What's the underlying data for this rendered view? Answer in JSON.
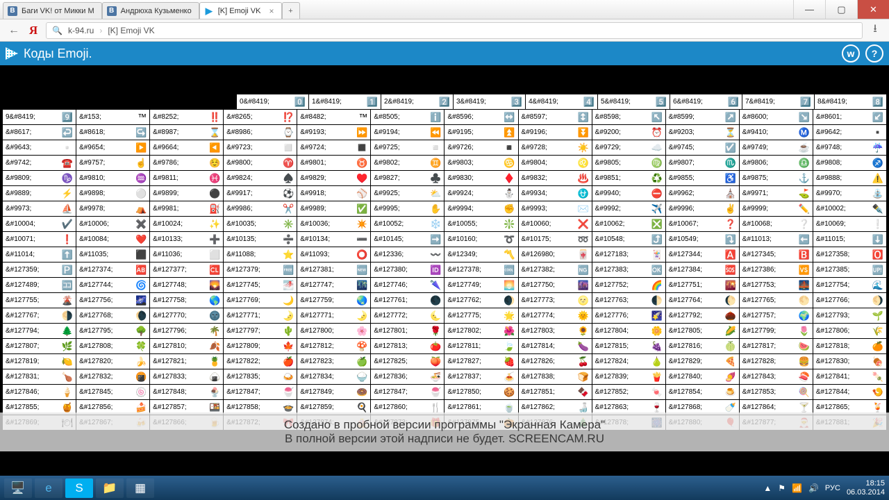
{
  "tabs": [
    {
      "fav": "vk",
      "label": "Баги VK! от Микки М"
    },
    {
      "fav": "vk",
      "label": "Андрюха Кузьменко"
    },
    {
      "fav": "play",
      "label": "[K] Emoji VK"
    }
  ],
  "address": {
    "host": "k-94.ru",
    "title": "[K] Emoji VK"
  },
  "header": {
    "title": "Коды Emoji."
  },
  "watermark": {
    "line1": "Создано в пробной версии программы \"Экранная Камера\"",
    "line2": "В полной версии этой надписи не будет. SCREENCAM.RU"
  },
  "tray": {
    "lang": "РУС",
    "time": "18:15",
    "date": "06.03.2014"
  },
  "firstRow": [
    {
      "c": "0&#8419;",
      "e": "0️⃣"
    },
    {
      "c": "1&#8419;",
      "e": "1️⃣"
    },
    {
      "c": "2&#8419;",
      "e": "2️⃣"
    },
    {
      "c": "3&#8419;",
      "e": "3️⃣"
    },
    {
      "c": "4&#8419;",
      "e": "4️⃣"
    },
    {
      "c": "5&#8419;",
      "e": "5️⃣"
    },
    {
      "c": "6&#8419;",
      "e": "6️⃣"
    },
    {
      "c": "7&#8419;",
      "e": "7️⃣"
    },
    {
      "c": "8&#8419;",
      "e": "8️⃣"
    }
  ],
  "rows": [
    [
      {
        "c": "9&#8419;",
        "e": "9️⃣"
      },
      {
        "c": "&#153;",
        "e": "™"
      },
      {
        "c": "&#8252;",
        "e": "‼️"
      },
      {
        "c": "&#8265;",
        "e": "⁉️"
      },
      {
        "c": "&#8482;",
        "e": "™"
      },
      {
        "c": "&#8505;",
        "e": "ℹ️"
      },
      {
        "c": "&#8596;",
        "e": "↔️"
      },
      {
        "c": "&#8597;",
        "e": "↕️"
      },
      {
        "c": "&#8598;",
        "e": "↖️"
      },
      {
        "c": "&#8599;",
        "e": "↗️"
      },
      {
        "c": "&#8600;",
        "e": "↘️"
      },
      {
        "c": "&#8601;",
        "e": "↙️"
      }
    ],
    [
      {
        "c": "&#8617;",
        "e": "↩️"
      },
      {
        "c": "&#8618;",
        "e": "↪️"
      },
      {
        "c": "&#8987;",
        "e": "⌛"
      },
      {
        "c": "&#8986;",
        "e": "⌚"
      },
      {
        "c": "&#9193;",
        "e": "⏩"
      },
      {
        "c": "&#9194;",
        "e": "⏪"
      },
      {
        "c": "&#9195;",
        "e": "⏫"
      },
      {
        "c": "&#9196;",
        "e": "⏬"
      },
      {
        "c": "&#9200;",
        "e": "⏰"
      },
      {
        "c": "&#9203;",
        "e": "⏳"
      },
      {
        "c": "&#9410;",
        "e": "Ⓜ️"
      },
      {
        "c": "&#9642;",
        "e": "▪️"
      }
    ],
    [
      {
        "c": "&#9643;",
        "e": "▫️"
      },
      {
        "c": "&#9654;",
        "e": "▶️"
      },
      {
        "c": "&#9664;",
        "e": "◀️"
      },
      {
        "c": "&#9723;",
        "e": "◻️"
      },
      {
        "c": "&#9724;",
        "e": "◼️"
      },
      {
        "c": "&#9725;",
        "e": "◽"
      },
      {
        "c": "&#9726;",
        "e": "◾"
      },
      {
        "c": "&#9728;",
        "e": "☀️"
      },
      {
        "c": "&#9729;",
        "e": "☁️"
      },
      {
        "c": "&#9745;",
        "e": "☑️"
      },
      {
        "c": "&#9749;",
        "e": "☕"
      },
      {
        "c": "&#9748;",
        "e": "☔"
      }
    ],
    [
      {
        "c": "&#9742;",
        "e": "☎️"
      },
      {
        "c": "&#9757;",
        "e": "☝️"
      },
      {
        "c": "&#9786;",
        "e": "☺️"
      },
      {
        "c": "&#9800;",
        "e": "♈"
      },
      {
        "c": "&#9801;",
        "e": "♉"
      },
      {
        "c": "&#9802;",
        "e": "♊"
      },
      {
        "c": "&#9803;",
        "e": "♋"
      },
      {
        "c": "&#9804;",
        "e": "♌"
      },
      {
        "c": "&#9805;",
        "e": "♍"
      },
      {
        "c": "&#9807;",
        "e": "♏"
      },
      {
        "c": "&#9806;",
        "e": "♎"
      },
      {
        "c": "&#9808;",
        "e": "♐"
      }
    ],
    [
      {
        "c": "&#9809;",
        "e": "♑"
      },
      {
        "c": "&#9810;",
        "e": "♒"
      },
      {
        "c": "&#9811;",
        "e": "♓"
      },
      {
        "c": "&#9824;",
        "e": "♠️"
      },
      {
        "c": "&#9829;",
        "e": "♥️"
      },
      {
        "c": "&#9827;",
        "e": "♣️"
      },
      {
        "c": "&#9830;",
        "e": "♦️"
      },
      {
        "c": "&#9832;",
        "e": "♨️"
      },
      {
        "c": "&#9851;",
        "e": "♻️"
      },
      {
        "c": "&#9855;",
        "e": "♿"
      },
      {
        "c": "&#9875;",
        "e": "⚓"
      },
      {
        "c": "&#9888;",
        "e": "⚠️"
      }
    ],
    [
      {
        "c": "&#9889;",
        "e": "⚡"
      },
      {
        "c": "&#9898;",
        "e": "⚪"
      },
      {
        "c": "&#9899;",
        "e": "⚫"
      },
      {
        "c": "&#9917;",
        "e": "⚽"
      },
      {
        "c": "&#9918;",
        "e": "⚾"
      },
      {
        "c": "&#9925;",
        "e": "⛅"
      },
      {
        "c": "&#9924;",
        "e": "⛄"
      },
      {
        "c": "&#9934;",
        "e": "⛎"
      },
      {
        "c": "&#9940;",
        "e": "⛔"
      },
      {
        "c": "&#9962;",
        "e": "⛪"
      },
      {
        "c": "&#9971;",
        "e": "⛳"
      },
      {
        "c": "&#9970;",
        "e": "⛲"
      }
    ],
    [
      {
        "c": "&#9973;",
        "e": "⛵"
      },
      {
        "c": "&#9978;",
        "e": "⛺"
      },
      {
        "c": "&#9981;",
        "e": "⛽"
      },
      {
        "c": "&#9986;",
        "e": "✂️"
      },
      {
        "c": "&#9989;",
        "e": "✅"
      },
      {
        "c": "&#9995;",
        "e": "✋"
      },
      {
        "c": "&#9994;",
        "e": "✊"
      },
      {
        "c": "&#9993;",
        "e": "✉️"
      },
      {
        "c": "&#9992;",
        "e": "✈️"
      },
      {
        "c": "&#9996;",
        "e": "✌️"
      },
      {
        "c": "&#9999;",
        "e": "✏️"
      },
      {
        "c": "&#10002;",
        "e": "✒️"
      }
    ],
    [
      {
        "c": "&#10004;",
        "e": "✔️"
      },
      {
        "c": "&#10006;",
        "e": "✖️"
      },
      {
        "c": "&#10024;",
        "e": "✨"
      },
      {
        "c": "&#10035;",
        "e": "✳️"
      },
      {
        "c": "&#10036;",
        "e": "✴️"
      },
      {
        "c": "&#10052;",
        "e": "❄️"
      },
      {
        "c": "&#10055;",
        "e": "❇️"
      },
      {
        "c": "&#10060;",
        "e": "❌"
      },
      {
        "c": "&#10062;",
        "e": "❎"
      },
      {
        "c": "&#10067;",
        "e": "❓"
      },
      {
        "c": "&#10068;",
        "e": "❔"
      },
      {
        "c": "&#10069;",
        "e": "❕"
      }
    ],
    [
      {
        "c": "&#10071;",
        "e": "❗"
      },
      {
        "c": "&#10084;",
        "e": "❤️"
      },
      {
        "c": "&#10133;",
        "e": "➕"
      },
      {
        "c": "&#10135;",
        "e": "➗"
      },
      {
        "c": "&#10134;",
        "e": "➖"
      },
      {
        "c": "&#10145;",
        "e": "➡️"
      },
      {
        "c": "&#10160;",
        "e": "➰"
      },
      {
        "c": "&#10175;",
        "e": "➿"
      },
      {
        "c": "&#10548;",
        "e": "⤴️"
      },
      {
        "c": "&#10549;",
        "e": "⤵️"
      },
      {
        "c": "&#11013;",
        "e": "⬅️"
      },
      {
        "c": "&#11015;",
        "e": "⬇️"
      }
    ],
    [
      {
        "c": "&#11014;",
        "e": "⬆️"
      },
      {
        "c": "&#11035;",
        "e": "⬛"
      },
      {
        "c": "&#11036;",
        "e": "⬜"
      },
      {
        "c": "&#11088;",
        "e": "⭐"
      },
      {
        "c": "&#11093;",
        "e": "⭕"
      },
      {
        "c": "&#12336;",
        "e": "〰️"
      },
      {
        "c": "&#12349;",
        "e": "〽️"
      },
      {
        "c": "&#126980;",
        "e": "🀄"
      },
      {
        "c": "&#127183;",
        "e": "🃏"
      },
      {
        "c": "&#127344;",
        "e": "🅰️"
      },
      {
        "c": "&#127345;",
        "e": "🅱️"
      },
      {
        "c": "&#127358;",
        "e": "🅾️"
      }
    ],
    [
      {
        "c": "&#127359;",
        "e": "🅿️"
      },
      {
        "c": "&#127374;",
        "e": "🆎"
      },
      {
        "c": "&#127377;",
        "e": "🆑"
      },
      {
        "c": "&#127379;",
        "e": "🆓"
      },
      {
        "c": "&#127381;",
        "e": "🆕"
      },
      {
        "c": "&#127380;",
        "e": "🆔"
      },
      {
        "c": "&#127378;",
        "e": "🆒"
      },
      {
        "c": "&#127382;",
        "e": "🆖"
      },
      {
        "c": "&#127383;",
        "e": "🆗"
      },
      {
        "c": "&#127384;",
        "e": "🆘"
      },
      {
        "c": "&#127386;",
        "e": "🆚"
      },
      {
        "c": "&#127385;",
        "e": "🆙"
      }
    ],
    [
      {
        "c": "&#127489;",
        "e": "🈁"
      },
      {
        "c": "&#127744;",
        "e": "🌀"
      },
      {
        "c": "&#127748;",
        "e": "🌄"
      },
      {
        "c": "&#127745;",
        "e": "🌁"
      },
      {
        "c": "&#127747;",
        "e": "🌃"
      },
      {
        "c": "&#127746;",
        "e": "🌂"
      },
      {
        "c": "&#127749;",
        "e": "🌅"
      },
      {
        "c": "&#127750;",
        "e": "🌆"
      },
      {
        "c": "&#127752;",
        "e": "🌈"
      },
      {
        "c": "&#127751;",
        "e": "🌇"
      },
      {
        "c": "&#127753;",
        "e": "🌉"
      },
      {
        "c": "&#127754;",
        "e": "🌊"
      }
    ],
    [
      {
        "c": "&#127755;",
        "e": "🌋"
      },
      {
        "c": "&#127756;",
        "e": "🌌"
      },
      {
        "c": "&#127758;",
        "e": "🌎"
      },
      {
        "c": "&#127769;",
        "e": "🌙"
      },
      {
        "c": "&#127759;",
        "e": "🌏"
      },
      {
        "c": "&#127761;",
        "e": "🌑"
      },
      {
        "c": "&#127762;",
        "e": "🌒"
      },
      {
        "c": "&#127773;",
        "e": "🌝"
      },
      {
        "c": "&#127763;",
        "e": "🌓"
      },
      {
        "c": "&#127764;",
        "e": "🌔"
      },
      {
        "c": "&#127765;",
        "e": "🌕"
      },
      {
        "c": "&#127766;",
        "e": "🌖"
      }
    ],
    [
      {
        "c": "&#127767;",
        "e": "🌗"
      },
      {
        "c": "&#127768;",
        "e": "🌘"
      },
      {
        "c": "&#127770;",
        "e": "🌚"
      },
      {
        "c": "&#127771;",
        "e": "🌛"
      },
      {
        "c": "&#127771;",
        "e": "🌛"
      },
      {
        "c": "&#127772;",
        "e": "🌜"
      },
      {
        "c": "&#127775;",
        "e": "🌟"
      },
      {
        "c": "&#127774;",
        "e": "🌞"
      },
      {
        "c": "&#127776;",
        "e": "🌠"
      },
      {
        "c": "&#127792;",
        "e": "🌰"
      },
      {
        "c": "&#127757;",
        "e": "🌍"
      },
      {
        "c": "&#127793;",
        "e": "🌱"
      }
    ],
    [
      {
        "c": "&#127794;",
        "e": "🌲"
      },
      {
        "c": "&#127795;",
        "e": "🌳"
      },
      {
        "c": "&#127796;",
        "e": "🌴"
      },
      {
        "c": "&#127797;",
        "e": "🌵"
      },
      {
        "c": "&#127800;",
        "e": "🌸"
      },
      {
        "c": "&#127801;",
        "e": "🌹"
      },
      {
        "c": "&#127802;",
        "e": "🌺"
      },
      {
        "c": "&#127803;",
        "e": "🌻"
      },
      {
        "c": "&#127804;",
        "e": "🌼"
      },
      {
        "c": "&#127805;",
        "e": "🌽"
      },
      {
        "c": "&#127799;",
        "e": "🌷"
      },
      {
        "c": "&#127806;",
        "e": "🌾"
      }
    ],
    [
      {
        "c": "&#127807;",
        "e": "🌿"
      },
      {
        "c": "&#127808;",
        "e": "🍀"
      },
      {
        "c": "&#127810;",
        "e": "🍂"
      },
      {
        "c": "&#127809;",
        "e": "🍁"
      },
      {
        "c": "&#127812;",
        "e": "🍄"
      },
      {
        "c": "&#127813;",
        "e": "🍅"
      },
      {
        "c": "&#127811;",
        "e": "🍃"
      },
      {
        "c": "&#127814;",
        "e": "🍆"
      },
      {
        "c": "&#127815;",
        "e": "🍇"
      },
      {
        "c": "&#127816;",
        "e": "🍈"
      },
      {
        "c": "&#127817;",
        "e": "🍉"
      },
      {
        "c": "&#127818;",
        "e": "🍊"
      }
    ],
    [
      {
        "c": "&#127819;",
        "e": "🍋"
      },
      {
        "c": "&#127820;",
        "e": "🍌"
      },
      {
        "c": "&#127821;",
        "e": "🍍"
      },
      {
        "c": "&#127822;",
        "e": "🍎"
      },
      {
        "c": "&#127823;",
        "e": "🍏"
      },
      {
        "c": "&#127825;",
        "e": "🍑"
      },
      {
        "c": "&#127827;",
        "e": "🍓"
      },
      {
        "c": "&#127826;",
        "e": "🍒"
      },
      {
        "c": "&#127824;",
        "e": "🍐"
      },
      {
        "c": "&#127829;",
        "e": "🍕"
      },
      {
        "c": "&#127828;",
        "e": "🍔"
      },
      {
        "c": "&#127830;",
        "e": "🍖"
      }
    ],
    [
      {
        "c": "&#127831;",
        "e": "🍗"
      },
      {
        "c": "&#127832;",
        "e": "🍘"
      },
      {
        "c": "&#127833;",
        "e": "🍙"
      },
      {
        "c": "&#127835;",
        "e": "🍛"
      },
      {
        "c": "&#127834;",
        "e": "🍚"
      },
      {
        "c": "&#127836;",
        "e": "🍜"
      },
      {
        "c": "&#127837;",
        "e": "🍝"
      },
      {
        "c": "&#127838;",
        "e": "🍞"
      },
      {
        "c": "&#127839;",
        "e": "🍟"
      },
      {
        "c": "&#127840;",
        "e": "🍠"
      },
      {
        "c": "&#127843;",
        "e": "🍣"
      },
      {
        "c": "&#127841;",
        "e": "🍡"
      }
    ],
    [
      {
        "c": "&#127846;",
        "e": "🍦"
      },
      {
        "c": "&#127845;",
        "e": "🍥"
      },
      {
        "c": "&#127848;",
        "e": "🍨"
      },
      {
        "c": "&#127847;",
        "e": "🍧"
      },
      {
        "c": "&#127849;",
        "e": "🍩"
      },
      {
        "c": "&#127847;",
        "e": "🍧"
      },
      {
        "c": "&#127850;",
        "e": "🍪"
      },
      {
        "c": "&#127851;",
        "e": "🍫"
      },
      {
        "c": "&#127852;",
        "e": "🍬"
      },
      {
        "c": "&#127854;",
        "e": "🍮"
      },
      {
        "c": "&#127853;",
        "e": "🍭"
      },
      {
        "c": "&#127844;",
        "e": "🍤"
      }
    ],
    [
      {
        "c": "&#127855;",
        "e": "🍯"
      },
      {
        "c": "&#127856;",
        "e": "🍰"
      },
      {
        "c": "&#127857;",
        "e": "🍱"
      },
      {
        "c": "&#127858;",
        "e": "🍲"
      },
      {
        "c": "&#127859;",
        "e": "🍳"
      },
      {
        "c": "&#127860;",
        "e": "🍴"
      },
      {
        "c": "&#127861;",
        "e": "🍵"
      },
      {
        "c": "&#127862;",
        "e": "🍶"
      },
      {
        "c": "&#127863;",
        "e": "🍷"
      },
      {
        "c": "&#127868;",
        "e": "🍼"
      },
      {
        "c": "&#127864;",
        "e": "🍸"
      },
      {
        "c": "&#127865;",
        "e": "🍹"
      }
    ],
    [
      {
        "c": "&#127869;",
        "e": "🍽"
      },
      {
        "c": "&#127867;",
        "e": "🍻"
      },
      {
        "c": "&#127866;",
        "e": "🍺"
      },
      {
        "c": "&#127872;",
        "e": "🎀"
      },
      {
        "c": "&#127874;",
        "e": "🎂"
      },
      {
        "c": "&#127873;",
        "e": "🎁"
      },
      {
        "c": "&#127875;",
        "e": "🎃"
      },
      {
        "c": "&#127876;",
        "e": "🎄"
      },
      {
        "c": "&#127878;",
        "e": "🎆"
      },
      {
        "c": "&#127880;",
        "e": "🎈"
      },
      {
        "c": "&#127877;",
        "e": "🎅"
      },
      {
        "c": "&#127881;",
        "e": "🎉"
      }
    ]
  ]
}
